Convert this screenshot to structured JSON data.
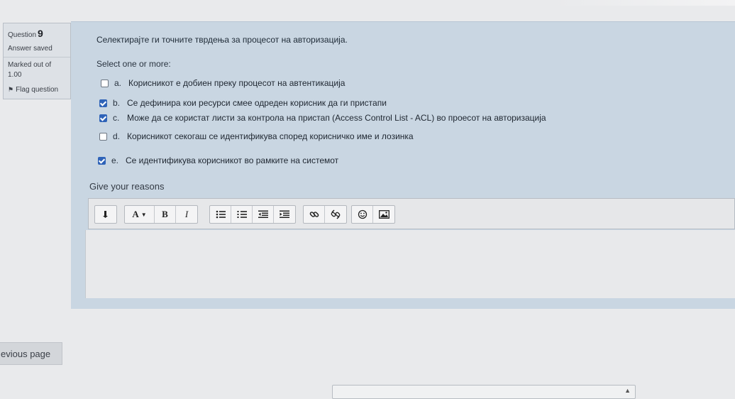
{
  "info": {
    "question_label": "Question",
    "question_number": "9",
    "state": "Answer saved",
    "marks": "Marked out of 1.00",
    "flag": "Flag question"
  },
  "question": {
    "text": "Селектирајте ги точните тврдења за процесот на авторизација.",
    "prompt": "Select one or more:",
    "options": [
      {
        "letter": "a.",
        "text": "Корисникот е добиен преку процесот на автентикација",
        "checked": false
      },
      {
        "letter": "b.",
        "text": "Се дефинира кои ресурси смее одреден корисник да ги пристапи",
        "checked": true
      },
      {
        "letter": "c.",
        "text": "Може да се користат листи за контрола на пристап (Access Control List - ACL) во проесот на авторизација",
        "checked": true
      },
      {
        "letter": "d.",
        "text": "Корисникот секогаш се идентификува според корисничко име и лозинка",
        "checked": false
      },
      {
        "letter": "e.",
        "text": "Се идентификува корисникот во рамките на системот",
        "checked": true
      }
    ]
  },
  "reasons": {
    "label": "Give your reasons"
  },
  "toolbar": {
    "font_color_label": "A",
    "bold_label": "B",
    "italic_label": "I"
  },
  "nav": {
    "previous_label": "evious page"
  },
  "colors": {
    "panel": "#c9d6e2",
    "checkbox_checked": "#2f63b8"
  }
}
